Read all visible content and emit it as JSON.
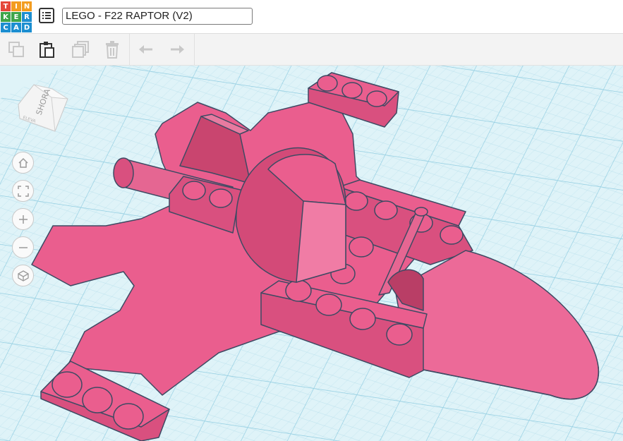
{
  "app": {
    "logo_letters": [
      "T",
      "I",
      "N",
      "K",
      "E",
      "R",
      "C",
      "A",
      "D"
    ],
    "logo_colors": [
      "#e5473a",
      "#f39c1f",
      "#f39c1f",
      "#3ea54a",
      "#3ea54a",
      "#1c8ed0",
      "#1c8ed0",
      "#1c8ed0",
      "#1c8ed0"
    ]
  },
  "header": {
    "design_title": "LEGO - F22 RAPTOR (V2)"
  },
  "toolbar": {
    "icons": [
      "copy-icon",
      "paste-icon",
      "duplicate-icon",
      "delete-icon",
      "undo-icon",
      "redo-icon"
    ]
  },
  "view_cube": {
    "front_label": "SHORA",
    "side_label": "ELEVA"
  },
  "nav_controls": [
    "home-view-icon",
    "fit-view-icon",
    "zoom-in-icon",
    "zoom-out-icon",
    "perspective-icon"
  ],
  "colors": {
    "model_pink": "#ea5e8e",
    "model_pink_dark": "#c9456f",
    "model_outline": "#3e4a63",
    "grid_background": "#dff3f8",
    "grid_line": "#a9d8e8"
  }
}
